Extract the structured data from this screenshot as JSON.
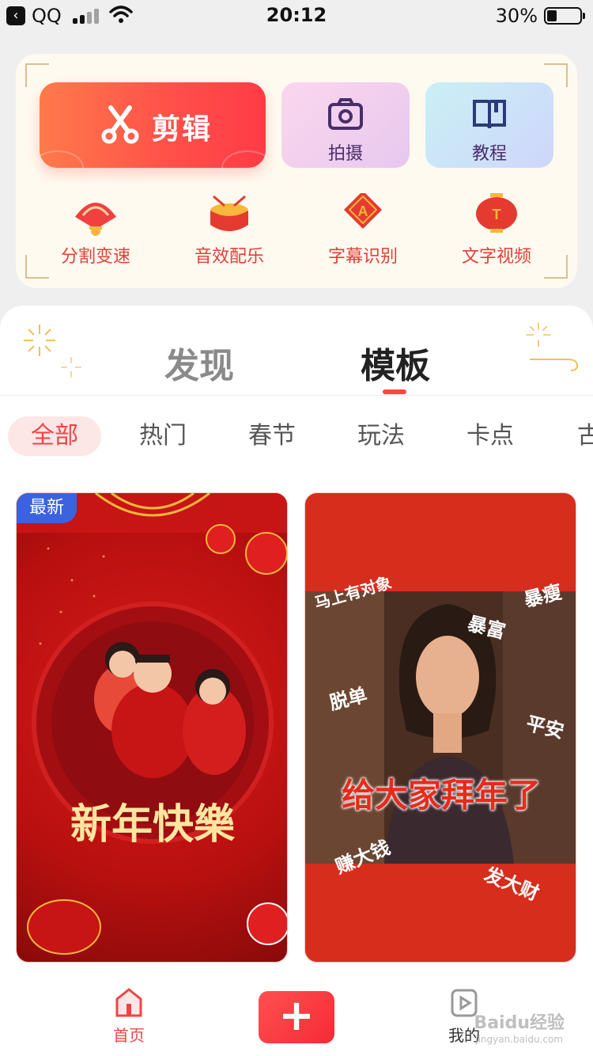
{
  "status_bar": {
    "back_app": "QQ",
    "time": "20:12",
    "battery_percent": "30%",
    "battery_level": 0.3
  },
  "tools": {
    "edit_label": "剪辑",
    "shoot_label": "拍摄",
    "tutorial_label": "教程",
    "mini_tools": [
      {
        "label": "分割变速",
        "icon": "fan-icon"
      },
      {
        "label": "音效配乐",
        "icon": "drum-icon"
      },
      {
        "label": "字幕识别",
        "icon": "lantern-diamond-icon"
      },
      {
        "label": "文字视频",
        "icon": "lantern-icon"
      }
    ]
  },
  "tabs": {
    "discover": "发现",
    "templates": "模板"
  },
  "categories": [
    "全部",
    "热门",
    "春节",
    "玩法",
    "卡点",
    "古"
  ],
  "cards": [
    {
      "badge": "最新",
      "title": "新年快樂"
    },
    {
      "title": "给大家拜年了",
      "tags": [
        "马上有对象",
        "暴瘦",
        "暴富",
        "脱单",
        "平安",
        "赚大钱",
        "发大财"
      ]
    }
  ],
  "bottom_nav": {
    "home_label": "首页",
    "add_label": "+",
    "mine_label": "我的",
    "watermark": "Baidu经验",
    "watermark_url": "jingyan.baidu.com"
  },
  "colors": {
    "accent": "#f04444",
    "badge": "#3b63e0",
    "card_bg": "#fffaf0"
  }
}
